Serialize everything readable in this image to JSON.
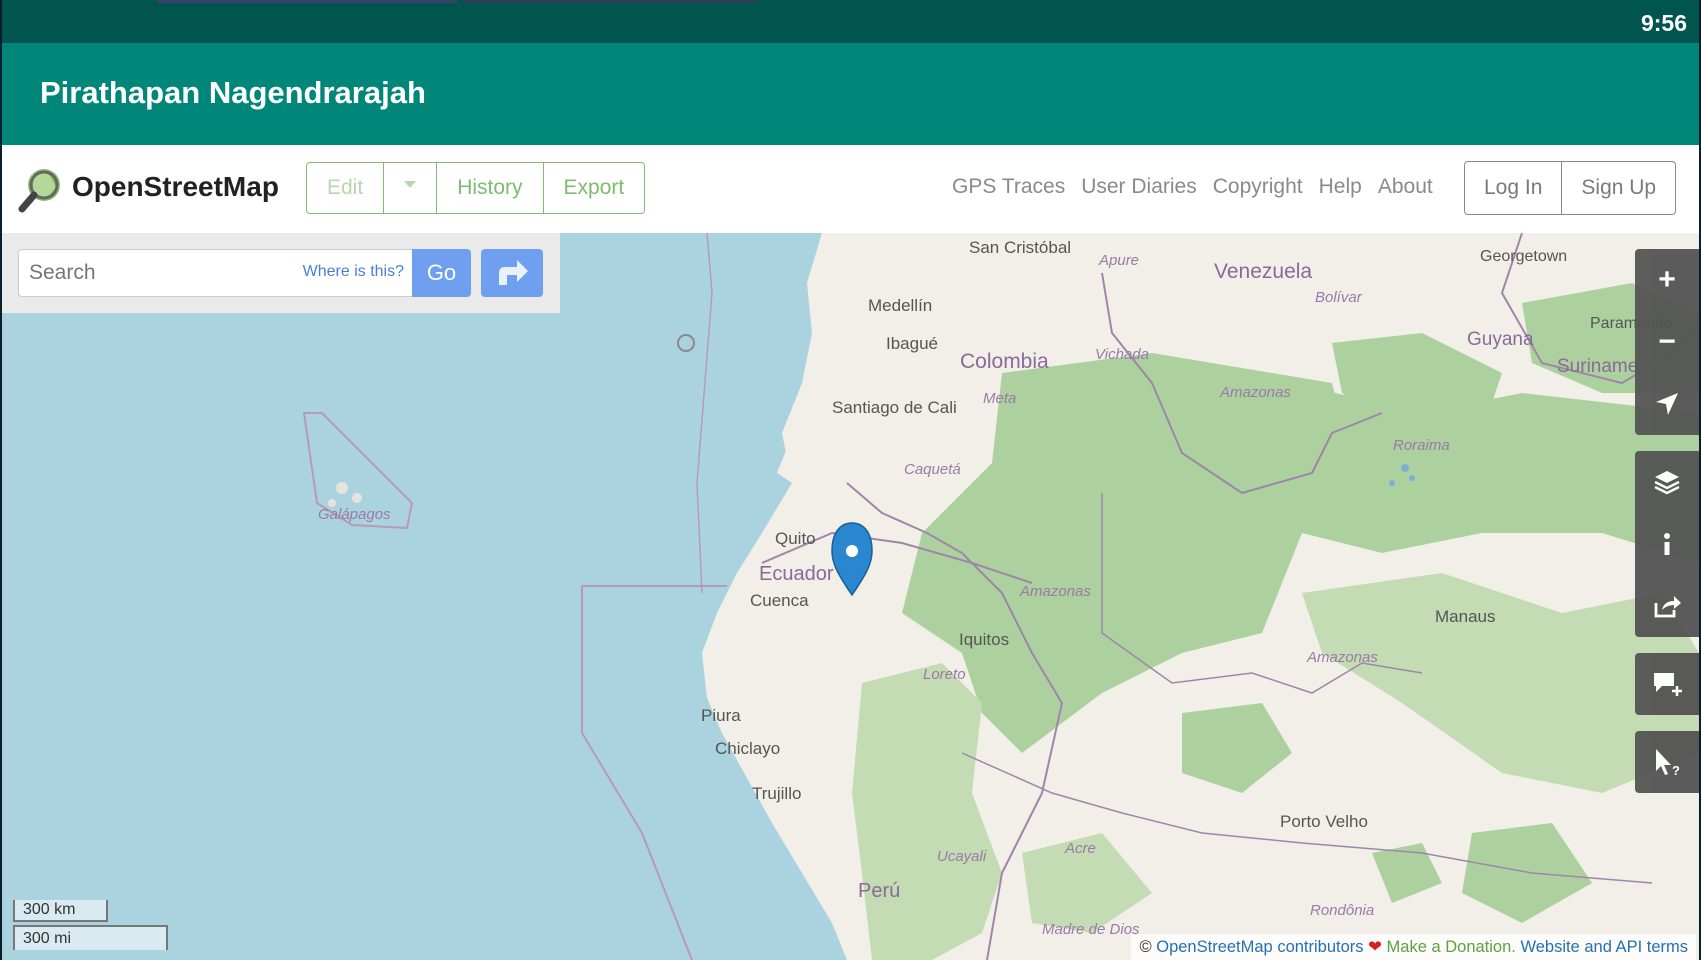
{
  "statusbar": {
    "time": "9:56"
  },
  "app": {
    "title": "Pirathapan Nagendrarajah"
  },
  "header": {
    "brand": "OpenStreetMap",
    "edit_label": "Edit",
    "history_label": "History",
    "export_label": "Export",
    "nav": [
      "GPS Traces",
      "User Diaries",
      "Copyright",
      "Help",
      "About"
    ],
    "login_label": "Log In",
    "signup_label": "Sign Up"
  },
  "search": {
    "placeholder": "Search",
    "where_label": "Where is this?",
    "go_label": "Go"
  },
  "map": {
    "places": [
      "San Cristóbal",
      "Apure",
      "Venezuela",
      "Bolívar",
      "Georgetown",
      "Paramaribo",
      "Guyana",
      "Suriname",
      "Medellín",
      "Ibagué",
      "Colombia",
      "Vichada",
      "Amazonas",
      "Meta",
      "Santiago de Cali",
      "Caquetá",
      "Roraima",
      "Galápagos",
      "Quito",
      "Ecuador",
      "Cuenca",
      "Amazonas",
      "Manaus",
      "Iquitos",
      "Amazonas",
      "Loreto",
      "Piura",
      "Chiclayo",
      "Trujillo",
      "Porto Velho",
      "Acre",
      "Ucayali",
      "Perú",
      "Rondônia",
      "Madre de Dios"
    ],
    "controls": [
      "zoom-in",
      "zoom-out",
      "locate",
      "layers",
      "info",
      "share",
      "add-note",
      "query"
    ]
  },
  "scale": {
    "km": "300 km",
    "mi": "300 mi"
  },
  "attribution": {
    "prefix": "©",
    "contributors": "OpenStreetMap contributors",
    "donation": "Make a Donation.",
    "terms": "Website and API terms"
  },
  "colors": {
    "primary": "#00877a",
    "statusbar": "#00564f",
    "osm_green": "#7ebc6f",
    "water": "#aad3df",
    "land": "#f2efe9",
    "forest": "#add19e",
    "search_blue": "#6fa0f0"
  }
}
